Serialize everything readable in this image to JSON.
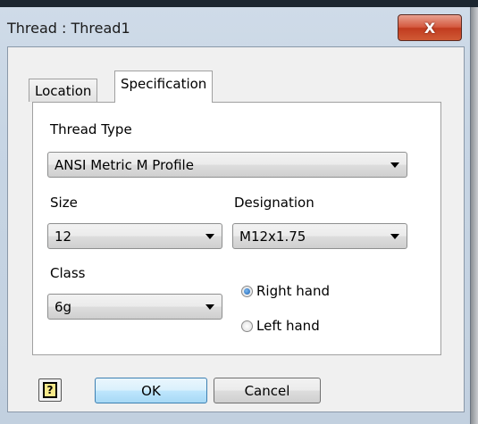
{
  "window": {
    "title": "Thread : Thread1",
    "close_glyph": "X"
  },
  "tabs": [
    {
      "label": "Location",
      "active": false
    },
    {
      "label": "Specification",
      "active": true
    }
  ],
  "spec": {
    "thread_type_label": "Thread Type",
    "thread_type_value": "ANSI Metric M Profile",
    "size_label": "Size",
    "size_value": "12",
    "designation_label": "Designation",
    "designation_value": "M12x1.75",
    "class_label": "Class",
    "class_value": "6g",
    "hand_options": [
      {
        "label": "Right hand",
        "selected": true
      },
      {
        "label": "Left hand",
        "selected": false
      }
    ]
  },
  "footer": {
    "help_glyph": "?",
    "ok_label": "OK",
    "cancel_label": "Cancel"
  },
  "colors": {
    "accent": "#3c7fb1",
    "close_button": "#c13b1f"
  },
  "icons": {
    "close": "close-icon",
    "help": "help-icon",
    "dropdown": "chevron-down-icon"
  }
}
